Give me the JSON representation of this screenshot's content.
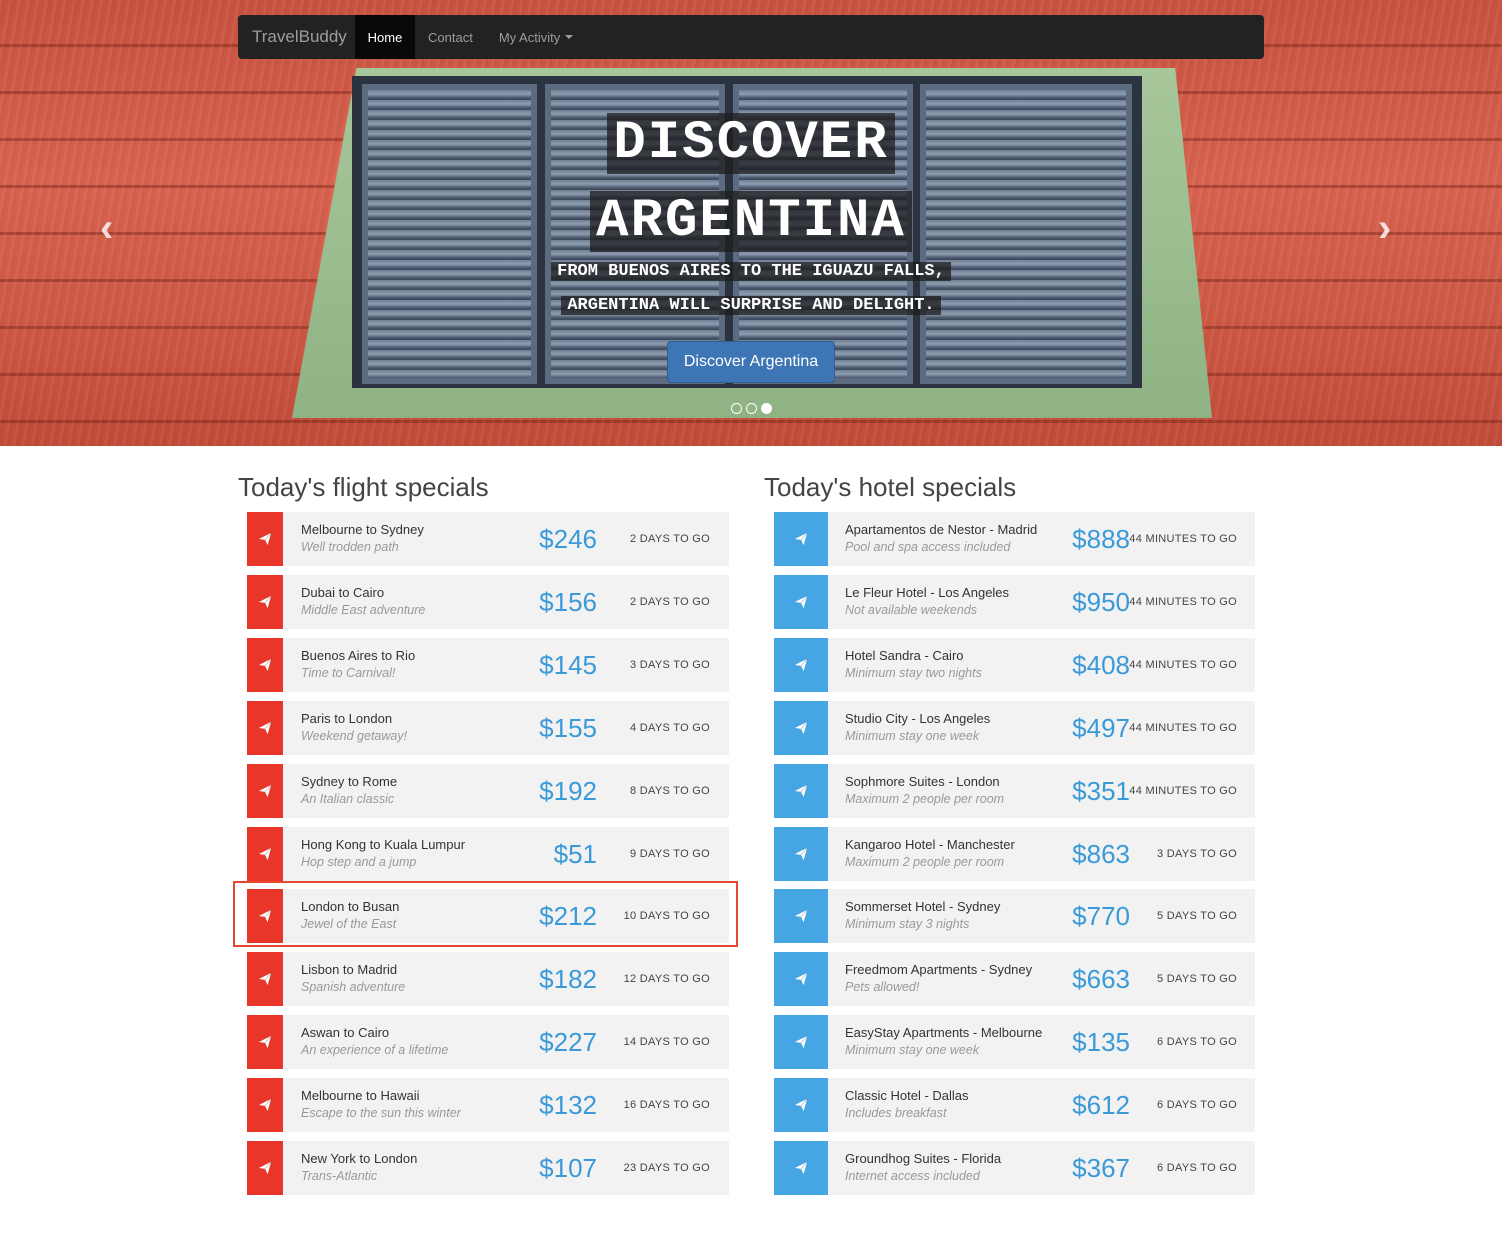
{
  "nav": {
    "brand": "TravelBuddy",
    "items": [
      "Home",
      "Contact",
      "My Activity"
    ]
  },
  "hero": {
    "title_line1": "DISCOVER",
    "title_line2": "ARGENTINA",
    "subtitle_line1": "FROM BUENOS AIRES TO THE IGUAZU FALLS,",
    "subtitle_line2": "ARGENTINA WILL SURPRISE AND DELIGHT.",
    "button": "Discover Argentina",
    "prev_arrow": "‹",
    "next_arrow": "›",
    "active_slide": 3,
    "slide_count": 3
  },
  "flights": {
    "title": "Today's flight specials",
    "items": [
      {
        "name": "Melbourne to Sydney",
        "sub": "Well trodden path",
        "price": "$246",
        "days": "2 DAYS TO GO"
      },
      {
        "name": "Dubai to Cairo",
        "sub": "Middle East adventure",
        "price": "$156",
        "days": "2 DAYS TO GO"
      },
      {
        "name": "Buenos Aires to Rio",
        "sub": "Time to Carnival!",
        "price": "$145",
        "days": "3 DAYS TO GO"
      },
      {
        "name": "Paris to London",
        "sub": "Weekend getaway!",
        "price": "$155",
        "days": "4 DAYS TO GO"
      },
      {
        "name": "Sydney to Rome",
        "sub": "An Italian classic",
        "price": "$192",
        "days": "8 DAYS TO GO"
      },
      {
        "name": "Hong Kong to Kuala Lumpur",
        "sub": "Hop step and a jump",
        "price": "$51",
        "days": "9 DAYS TO GO"
      },
      {
        "name": "London to Busan",
        "sub": "Jewel of the East",
        "price": "$212",
        "days": "10 DAYS TO GO"
      },
      {
        "name": "Lisbon to Madrid",
        "sub": "Spanish adventure",
        "price": "$182",
        "days": "12 DAYS TO GO"
      },
      {
        "name": "Aswan to Cairo",
        "sub": "An experience of a lifetime",
        "price": "$227",
        "days": "14 DAYS TO GO"
      },
      {
        "name": "Melbourne to Hawaii",
        "sub": "Escape to the sun this winter",
        "price": "$132",
        "days": "16 DAYS TO GO"
      },
      {
        "name": "New York to London",
        "sub": "Trans-Atlantic",
        "price": "$107",
        "days": "23 DAYS TO GO"
      }
    ]
  },
  "hotels": {
    "title": "Today's hotel specials",
    "items": [
      {
        "name": "Apartamentos de Nestor - Madrid",
        "sub": "Pool and spa access included",
        "price": "$888",
        "days": "44 MINUTES TO GO"
      },
      {
        "name": "Le Fleur Hotel - Los Angeles",
        "sub": "Not available weekends",
        "price": "$950",
        "days": "44 MINUTES TO GO"
      },
      {
        "name": "Hotel Sandra - Cairo",
        "sub": "Minimum stay two nights",
        "price": "$408",
        "days": "44 MINUTES TO GO"
      },
      {
        "name": "Studio City - Los Angeles",
        "sub": "Minimum stay one week",
        "price": "$497",
        "days": "44 MINUTES TO GO"
      },
      {
        "name": "Sophmore Suites - London",
        "sub": "Maximum 2 people per room",
        "price": "$351",
        "days": "44 MINUTES TO GO"
      },
      {
        "name": "Kangaroo Hotel - Manchester",
        "sub": "Maximum 2 people per room",
        "price": "$863",
        "days": "3 DAYS TO GO"
      },
      {
        "name": "Sommerset Hotel - Sydney",
        "sub": "Minimum stay 3 nights",
        "price": "$770",
        "days": "5 DAYS TO GO"
      },
      {
        "name": "Freedmom Apartments - Sydney",
        "sub": "Pets allowed!",
        "price": "$663",
        "days": "5 DAYS TO GO"
      },
      {
        "name": "EasyStay Apartments - Melbourne",
        "sub": "Minimum stay one week",
        "price": "$135",
        "days": "6 DAYS TO GO"
      },
      {
        "name": "Classic Hotel - Dallas",
        "sub": "Includes breakfast",
        "price": "$612",
        "days": "6 DAYS TO GO"
      },
      {
        "name": "Groundhog Suites - Florida",
        "sub": "Internet access included",
        "price": "$367",
        "days": "6 DAYS TO GO"
      }
    ]
  },
  "colors": {
    "flight_accent": "#e8362a",
    "hotel_accent": "#46a6e3",
    "price": "#3a9ad9",
    "navbar": "#222222",
    "hero_button": "#3d75b5",
    "highlight": "#e2492f"
  },
  "icons": {
    "row_icon": "paper-plane-icon",
    "prev": "chevron-left-icon",
    "next": "chevron-right-icon"
  },
  "highlighted_row": "London to Busan"
}
